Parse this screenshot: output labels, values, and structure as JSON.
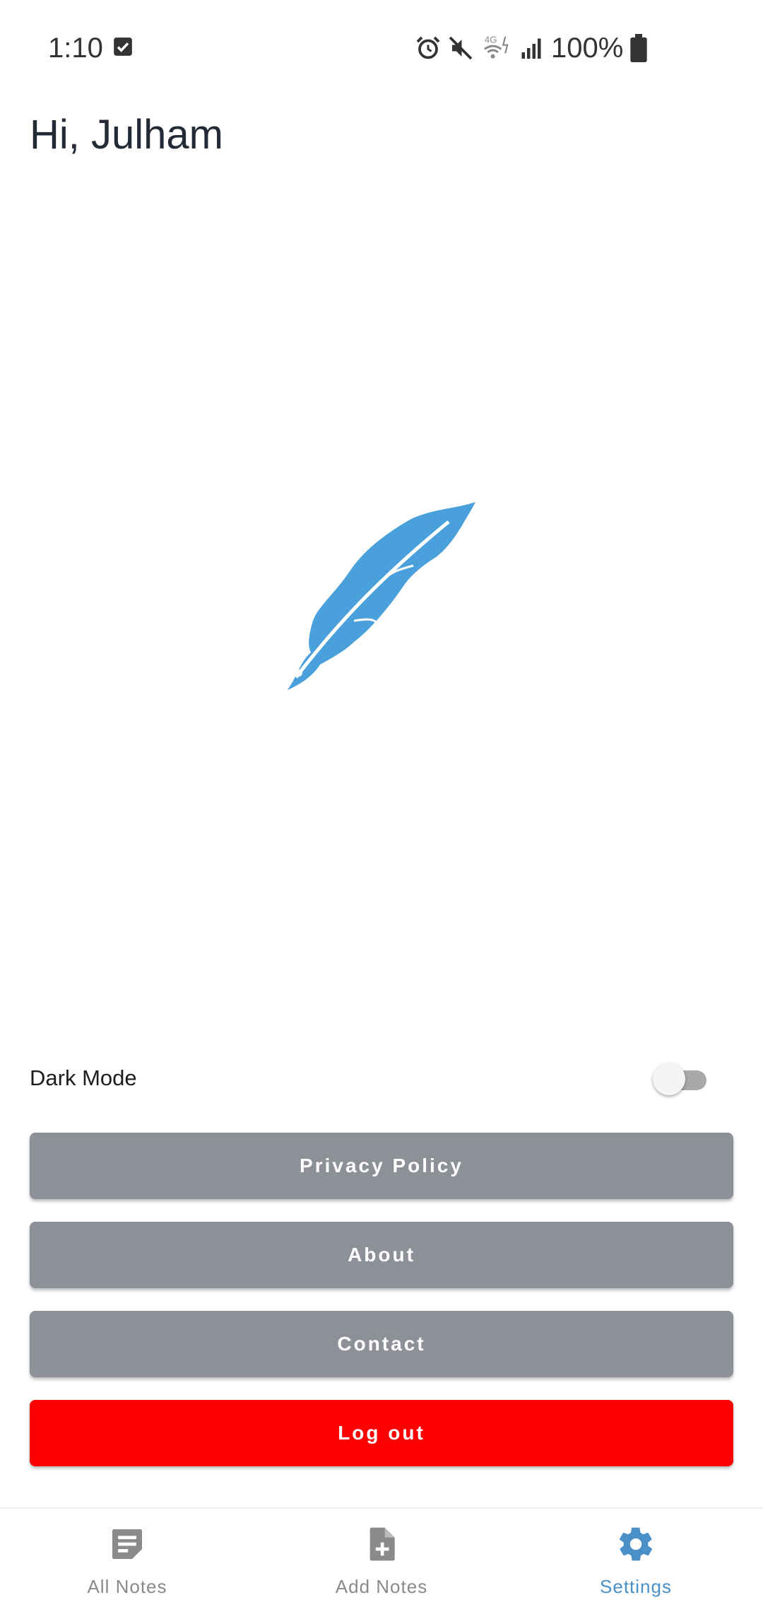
{
  "status_bar": {
    "time": "1:10",
    "battery_text": "100%",
    "network_label": "4G",
    "icons": [
      "check-square-icon",
      "alarm-icon",
      "mute-icon",
      "wifi-icon",
      "data-arrows-icon",
      "signal-icon",
      "battery-icon"
    ]
  },
  "greeting": "Hi, Julham",
  "logo": {
    "icon": "feather-quill-icon",
    "color": "#4aa0da"
  },
  "settings": {
    "dark_mode_label": "Dark Mode",
    "dark_mode_on": false
  },
  "buttons": {
    "privacy": "Privacy Policy",
    "about": "About",
    "contact": "Contact",
    "logout": "Log out"
  },
  "bottom_nav": {
    "items": [
      {
        "label": "All Notes",
        "icon": "notes-icon",
        "active": false
      },
      {
        "label": "Add Notes",
        "icon": "add-note-icon",
        "active": false
      },
      {
        "label": "Settings",
        "icon": "gear-icon",
        "active": true
      }
    ]
  },
  "colors": {
    "accent": "#4a90c8",
    "button_gray": "#8e9098",
    "logout_red": "#ff0000",
    "nav_inactive": "#8a8a8a"
  }
}
